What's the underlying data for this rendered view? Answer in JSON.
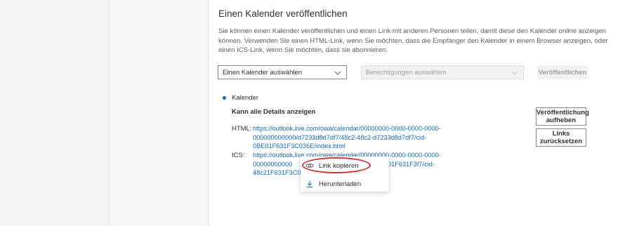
{
  "publish": {
    "title": "Einen Kalender veröffentlichen",
    "description": "Sie können einen Kalender veröffentlichen und einen Link mit anderen Personen teilen, damit diese den Kalender online anzeigen können. Verwenden Sie einen HTML-Link, wenn Sie möchten, dass die Empfänger den Kalender in einem Browser anzeigen, oder einen ICS-Link, wenn Sie möchten, dass sie abonnieren.",
    "calendar_select": "Einen Kalender auswählen",
    "permission_select": "Berechtigungen auswählen",
    "publish_button": "Veröffentlichen"
  },
  "published": {
    "calendar_name": "Kalender",
    "permission": "Kann alle Details anzeigen",
    "html_label": "HTML:",
    "html_link_lines": [
      "https://outlook.live.com/owa/calendar/00000000-0000-0000-0000-",
      "000000000000/d7233d8d7df7/48c2-48c2-d7233d8d7df7/cid-",
      "0BE01F631F3C036E/index.html"
    ],
    "ics_label": "ICS:",
    "ics_link_lines": [
      "https://outlook.live.com/owa/calendar/00000000-0000-0000-0000-",
      "00000000000",
      "01F631F3f7/cid-",
      "48c21F631F3C0"
    ],
    "unpublish_button": [
      "Veröffentlichung",
      "aufheben"
    ],
    "reset_button": [
      "Links",
      "zurücksetzen"
    ]
  },
  "context_menu": {
    "copy_link": "Link kopieren",
    "download": "Herunterladen"
  },
  "colors": {
    "accent": "#0f6cbd",
    "annotation": "#d0302f"
  }
}
